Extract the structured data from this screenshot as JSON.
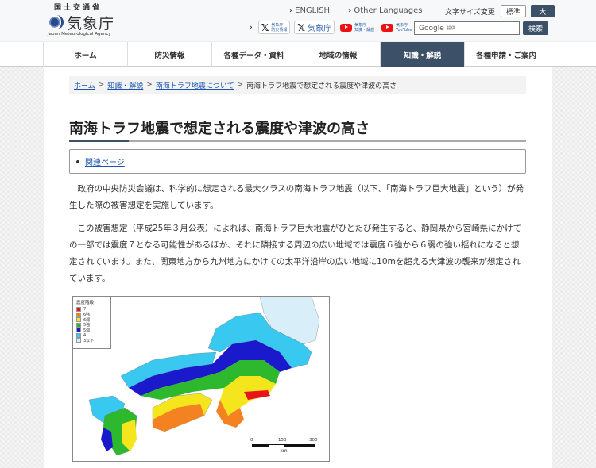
{
  "header": {
    "ministry": "国土交通省",
    "agency_name": "気象庁",
    "agency_english": "Japan Meteorological Agency",
    "lang_links": [
      "ENGLISH",
      "Other Languages"
    ],
    "social_links": [
      {
        "type": "x",
        "label_line1": "気象庁",
        "label_line2": "防災情報",
        "icon": "x-logo-icon"
      },
      {
        "type": "x",
        "label": "気象庁",
        "icon": "x-logo-icon"
      },
      {
        "type": "youtube",
        "label_line1": "気象庁",
        "label_line2": "知識・解説",
        "icon": "youtube-logo-icon"
      },
      {
        "type": "youtube",
        "label_line1": "気象庁",
        "label_line2": "YouTube",
        "icon": "youtube-logo-icon"
      }
    ],
    "font_size": {
      "label": "文字サイズ変更",
      "standard": "標準",
      "large": "大"
    },
    "search": {
      "placeholder_brand": "Google",
      "placeholder_suffix": "提供",
      "button": "検索"
    }
  },
  "nav": {
    "items": [
      "ホーム",
      "防災情報",
      "各種データ・資料",
      "地域の情報",
      "知識・解説",
      "各種申請・ご案内"
    ],
    "active_index": 4
  },
  "breadcrumb": {
    "items": [
      "ホーム",
      "知識・解説",
      "南海トラフ地震について"
    ],
    "current": "南海トラフ地震で想定される震度や津波の高さ",
    "separator": ">"
  },
  "page": {
    "title": "南海トラフ地震で想定される震度や津波の高さ",
    "related_link": "関連ページ",
    "paragraphs": [
      "政府の中央防災会議は、科学的に想定される最大クラスの南海トラフ地震（以下、「南海トラフ巨大地震」という）が発生した際の被害想定を実施しています。",
      "この被害想定（平成25年３月公表）によれば、南海トラフ巨大地震がひとたび発生すると、静岡県から宮崎県にかけての一部では震度７となる可能性があるほか、それに隣接する周辺の広い地域では震度６強から６弱の強い揺れになると想定されています。また、関東地方から九州地方にかけての太平洋沿岸の広い地域に10mを超える大津波の襲来が想定されています。"
    ]
  },
  "map": {
    "legend_title": "震度階級",
    "legend": [
      {
        "label": "7",
        "color": "#e8141a"
      },
      {
        "label": "6強",
        "color": "#f58220"
      },
      {
        "label": "6弱",
        "color": "#f4e51c"
      },
      {
        "label": "5強",
        "color": "#2eb82e"
      },
      {
        "label": "5弱",
        "color": "#1a1acc"
      },
      {
        "label": "4",
        "color": "#38c8f0"
      },
      {
        "label": "3以下",
        "color": "#d8eef8"
      }
    ],
    "scale": {
      "ticks": [
        "0",
        "150",
        "300"
      ],
      "unit": "km"
    }
  },
  "colors": {
    "accent_dark": "#3c5068",
    "link": "#1a56b0"
  }
}
